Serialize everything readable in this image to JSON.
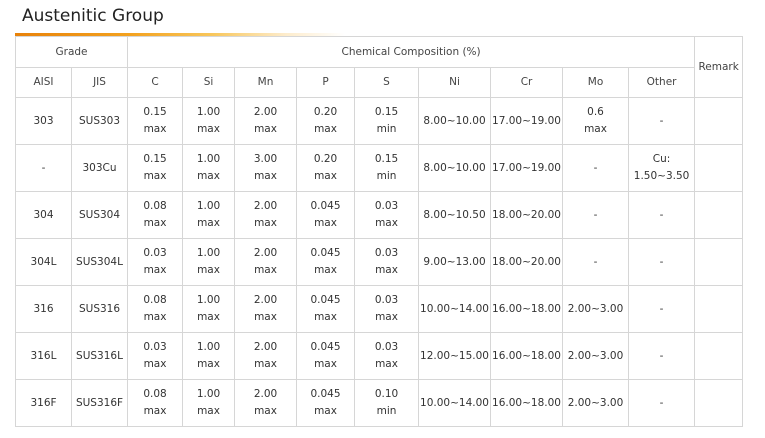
{
  "title": "Austenitic Group",
  "headers": {
    "grade": "Grade",
    "chemical_composition": "Chemical Composition (%)",
    "remark": "Remark",
    "columns": [
      "AISI",
      "JIS",
      "C",
      "Si",
      "Mn",
      "P",
      "S",
      "Ni",
      "Cr",
      "Mo",
      "Other"
    ]
  },
  "rows": [
    {
      "aisi": "303",
      "jis": "SUS303",
      "c": [
        "0.15",
        "max"
      ],
      "si": [
        "1.00",
        "max"
      ],
      "mn": [
        "2.00",
        "max"
      ],
      "p": [
        "0.20",
        "max"
      ],
      "s": [
        "0.15",
        "min"
      ],
      "ni": "8.00~10.00",
      "cr": "17.00~19.00",
      "mo": [
        "0.6",
        "max"
      ],
      "other": [
        "-",
        ""
      ],
      "remark": ""
    },
    {
      "aisi": "-",
      "jis": "303Cu",
      "c": [
        "0.15",
        "max"
      ],
      "si": [
        "1.00",
        "max"
      ],
      "mn": [
        "3.00",
        "max"
      ],
      "p": [
        "0.20",
        "max"
      ],
      "s": [
        "0.15",
        "min"
      ],
      "ni": "8.00~10.00",
      "cr": "17.00~19.00",
      "mo": [
        "-",
        ""
      ],
      "other": [
        "Cu:",
        "1.50~3.50"
      ],
      "remark": ""
    },
    {
      "aisi": "304",
      "jis": "SUS304",
      "c": [
        "0.08",
        "max"
      ],
      "si": [
        "1.00",
        "max"
      ],
      "mn": [
        "2.00",
        "max"
      ],
      "p": [
        "0.045",
        "max"
      ],
      "s": [
        "0.03",
        "max"
      ],
      "ni": "8.00~10.50",
      "cr": "18.00~20.00",
      "mo": [
        "-",
        ""
      ],
      "other": [
        "-",
        ""
      ],
      "remark": ""
    },
    {
      "aisi": "304L",
      "jis": "SUS304L",
      "c": [
        "0.03",
        "max"
      ],
      "si": [
        "1.00",
        "max"
      ],
      "mn": [
        "2.00",
        "max"
      ],
      "p": [
        "0.045",
        "max"
      ],
      "s": [
        "0.03",
        "max"
      ],
      "ni": "9.00~13.00",
      "cr": "18.00~20.00",
      "mo": [
        "-",
        ""
      ],
      "other": [
        "-",
        ""
      ],
      "remark": ""
    },
    {
      "aisi": "316",
      "jis": "SUS316",
      "c": [
        "0.08",
        "max"
      ],
      "si": [
        "1.00",
        "max"
      ],
      "mn": [
        "2.00",
        "max"
      ],
      "p": [
        "0.045",
        "max"
      ],
      "s": [
        "0.03",
        "max"
      ],
      "ni": "10.00~14.00",
      "cr": "16.00~18.00",
      "mo": [
        "2.00~3.00",
        ""
      ],
      "other": [
        "-",
        ""
      ],
      "remark": ""
    },
    {
      "aisi": "316L",
      "jis": "SUS316L",
      "c": [
        "0.03",
        "max"
      ],
      "si": [
        "1.00",
        "max"
      ],
      "mn": [
        "2.00",
        "max"
      ],
      "p": [
        "0.045",
        "max"
      ],
      "s": [
        "0.03",
        "max"
      ],
      "ni": "12.00~15.00",
      "cr": "16.00~18.00",
      "mo": [
        "2.00~3.00",
        ""
      ],
      "other": [
        "-",
        ""
      ],
      "remark": ""
    },
    {
      "aisi": "316F",
      "jis": "SUS316F",
      "c": [
        "0.08",
        "max"
      ],
      "si": [
        "1.00",
        "max"
      ],
      "mn": [
        "2.00",
        "max"
      ],
      "p": [
        "0.045",
        "max"
      ],
      "s": [
        "0.10",
        "min"
      ],
      "ni": "10.00~14.00",
      "cr": "16.00~18.00",
      "mo": [
        "2.00~3.00",
        ""
      ],
      "other": [
        "-",
        ""
      ],
      "remark": ""
    }
  ]
}
